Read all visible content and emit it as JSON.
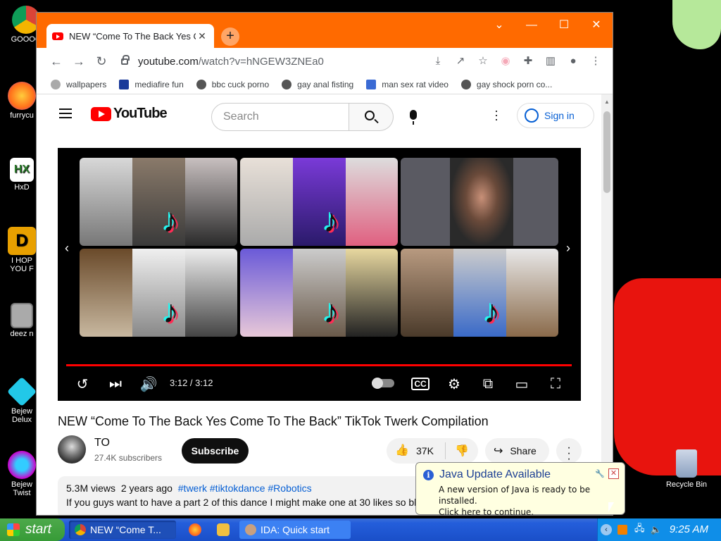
{
  "desktop": {
    "icons": [
      {
        "label": "GOOOO"
      },
      {
        "label": "furrycu"
      },
      {
        "label": "HxD"
      },
      {
        "label": "I HOP YOU F"
      },
      {
        "label": "deez n"
      },
      {
        "label": "Bejew Delux"
      },
      {
        "label": "Bejew Twist"
      }
    ],
    "recycle_bin": "Recycle Bin"
  },
  "browser": {
    "tab_title": "NEW “Come To The Back Yes C",
    "url_host": "youtube.com",
    "url_path": "/watch?v=hNGEW3ZNEa0",
    "bookmarks": [
      "wallpapers",
      "mediafire fun",
      "bbc cuck porno",
      "gay anal fisting",
      "man sex rat video",
      "gay shock porn co..."
    ]
  },
  "youtube": {
    "search_placeholder": "Search",
    "sign_in": "Sign in",
    "player": {
      "time": "3:12 / 3:12",
      "progress": 1.0
    },
    "video_title": "NEW “Come To The Back Yes Come To The Back” TikTok Twerk Compilation",
    "channel_name": "TO",
    "subscribers": "27.4K subscribers",
    "subscribe_label": "Subscribe",
    "likes": "37K",
    "share_label": "Share",
    "views": "5.3M views",
    "uploaded": "2 years ago",
    "tags": "#twerk #tiktokdance #Robotics",
    "description": "If you guys want to have a part 2 of this dance I might make one at 30 likes so bl"
  },
  "java_balloon": {
    "title": "Java Update Available",
    "line1": "A new version of Java is ready to be installed.",
    "line2": "Click here to continue."
  },
  "taskbar": {
    "start": "start",
    "tasks": [
      "NEW “Come T...",
      "IDA: Quick start"
    ],
    "clock": "9:25 AM"
  },
  "colors": {
    "tab_strip": "#ff6a00",
    "yt_red": "#ff0000",
    "link_blue": "#065fd4"
  }
}
